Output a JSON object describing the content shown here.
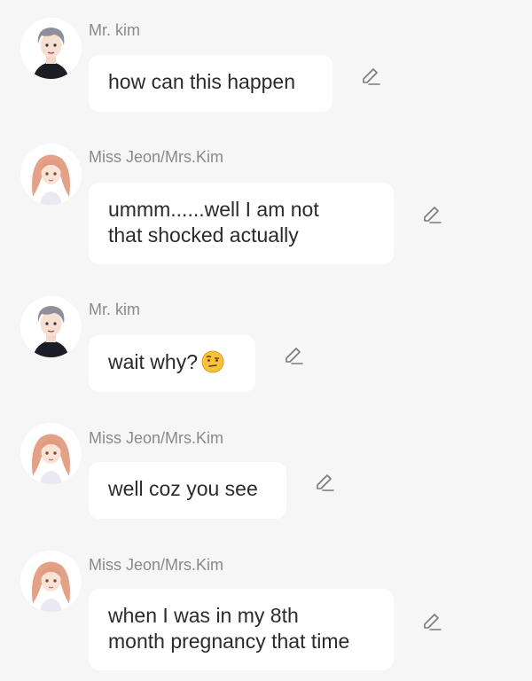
{
  "messages": [
    {
      "sender": "Mr. kim",
      "avatar_icon": "male-character-avatar",
      "lines": [
        "how can this happen"
      ],
      "emoji": ""
    },
    {
      "sender": "Miss Jeon/Mrs.Kim",
      "avatar_icon": "female-character-avatar",
      "lines": [
        "ummm......well I am not",
        "that shocked actually"
      ],
      "emoji": ""
    },
    {
      "sender": "Mr. kim",
      "avatar_icon": "male-character-avatar",
      "lines": [
        "wait why?"
      ],
      "emoji": "raised-eyebrow-emoji"
    },
    {
      "sender": "Miss Jeon/Mrs.Kim",
      "avatar_icon": "female-character-avatar",
      "lines": [
        "well coz you see"
      ],
      "emoji": ""
    },
    {
      "sender": "Miss Jeon/Mrs.Kim",
      "avatar_icon": "female-character-avatar",
      "lines": [
        "when I was in my 8th",
        "month pregnancy that time"
      ],
      "emoji": ""
    }
  ],
  "colors": {
    "background": "#f6f6f6",
    "bubble": "#ffffff",
    "sender_name": "#8a8a8a",
    "message_text": "#2b2b2b",
    "edit_icon": "#7a7a7a"
  }
}
